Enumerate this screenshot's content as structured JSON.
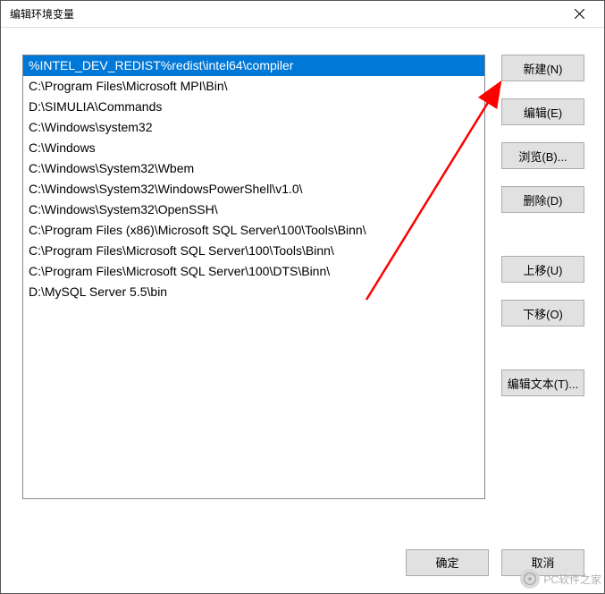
{
  "window": {
    "title": "编辑环境变量"
  },
  "list": {
    "items": [
      "%INTEL_DEV_REDIST%redist\\intel64\\compiler",
      "C:\\Program Files\\Microsoft MPI\\Bin\\",
      "D:\\SIMULIA\\Commands",
      "C:\\Windows\\system32",
      "C:\\Windows",
      "C:\\Windows\\System32\\Wbem",
      "C:\\Windows\\System32\\WindowsPowerShell\\v1.0\\",
      "C:\\Windows\\System32\\OpenSSH\\",
      "C:\\Program Files (x86)\\Microsoft SQL Server\\100\\Tools\\Binn\\",
      "C:\\Program Files\\Microsoft SQL Server\\100\\Tools\\Binn\\",
      "C:\\Program Files\\Microsoft SQL Server\\100\\DTS\\Binn\\",
      "D:\\MySQL Server 5.5\\bin"
    ],
    "selected_index": 0
  },
  "buttons": {
    "new": "新建(N)",
    "edit": "编辑(E)",
    "browse": "浏览(B)...",
    "delete": "删除(D)",
    "move_up": "上移(U)",
    "move_down": "下移(O)",
    "edit_text": "编辑文本(T)...",
    "ok": "确定",
    "cancel": "取消"
  },
  "annotation": {
    "arrow_color": "#ff0000"
  },
  "watermark": {
    "text": "PC软件之家"
  }
}
